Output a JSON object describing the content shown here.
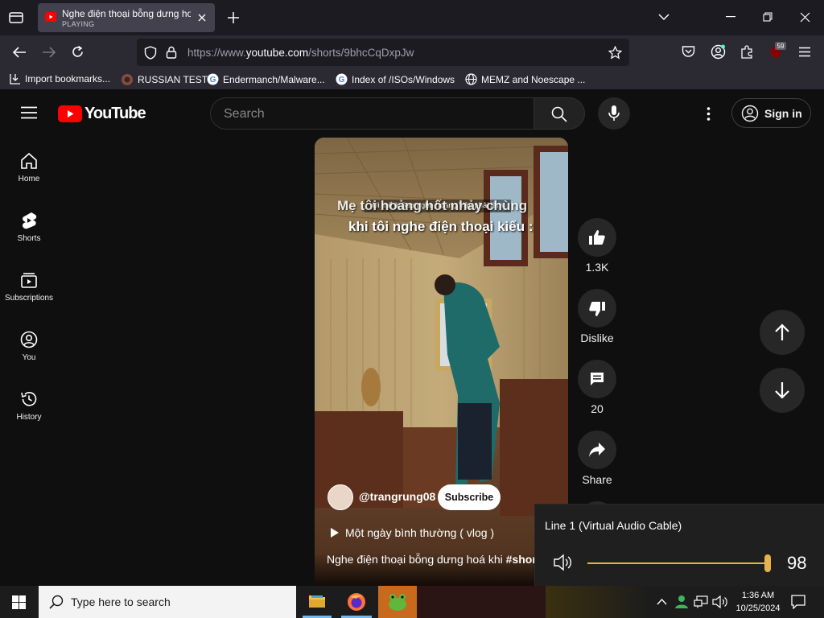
{
  "browser": {
    "tab": {
      "title": "Nghe điện thoại bỗng dưng hoá",
      "status": "PLAYING"
    },
    "url": {
      "prefix": "https://www.",
      "host": "youtube.com",
      "path": "/shorts/9bhcCqDxpJw"
    },
    "extension_badge": "59",
    "bookmarks": [
      "Import bookmarks...",
      "RUSSIAN TEST",
      "Endermanch/Malware...",
      "Index of /ISOs/Windows",
      "MEMZ and Noescape ..."
    ]
  },
  "youtube": {
    "logo_text": "YouTube",
    "search_placeholder": "Search",
    "sign_in": "Sign in",
    "sidebar": [
      {
        "label": "Home",
        "icon": "home-icon"
      },
      {
        "label": "Shorts",
        "icon": "shorts-icon"
      },
      {
        "label": "Subscriptions",
        "icon": "subscriptions-icon"
      },
      {
        "label": "You",
        "icon": "you-icon"
      },
      {
        "label": "History",
        "icon": "history-icon"
      }
    ],
    "short": {
      "overlay_top": "Ui thế à Sao nghe hoảng Vậy phải lắm",
      "overlay_line1": "Mẹ tôi hoảng hốt nhảy chùng",
      "overlay_line2": "khi tôi nghe điện thoại kiểu :",
      "channel": "@trangrung08",
      "subscribe": "Subscribe",
      "playlist": "Một ngày bình thường ( vlog )",
      "title": "Nghe điện thoại bỗng dưng hoá khi ",
      "hashtag": "#shor"
    },
    "actions": {
      "likes": "1.3K",
      "dislike": "Dislike",
      "comments": "20",
      "share": "Share"
    }
  },
  "volume": {
    "device": "Line 1 (Virtual Audio Cable)",
    "level": 98
  },
  "taskbar": {
    "search_placeholder": "Type here to search",
    "time": "1:36 AM",
    "date": "10/25/2024"
  },
  "colors": {
    "yt_red": "#ff0000",
    "volume_accent": "#e8b24a",
    "background": "#0f0f0f"
  }
}
